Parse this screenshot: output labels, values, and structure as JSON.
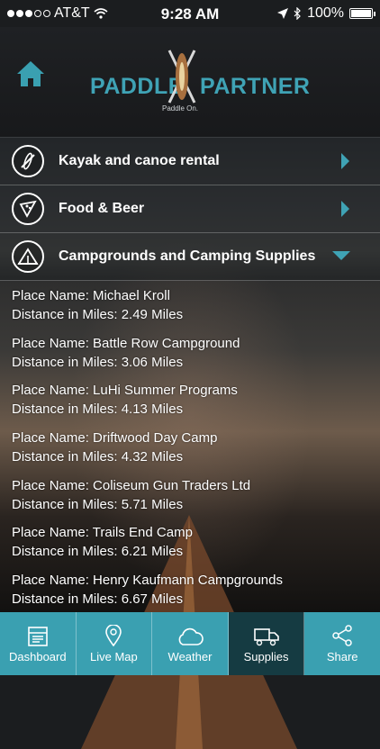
{
  "status": {
    "carrier": "AT&T",
    "time": "9:28 AM",
    "battery": "100%"
  },
  "header": {
    "logo_word1": "PADDLE",
    "logo_word2": "PARTNER",
    "tagline": "Paddle On."
  },
  "categories": [
    {
      "label": "Kayak and canoe rental",
      "icon": "kayak-icon",
      "expanded": false
    },
    {
      "label": "Food & Beer",
      "icon": "pizza-icon",
      "expanded": false
    },
    {
      "label": "Campgrounds and Camping Supplies",
      "icon": "tent-icon",
      "expanded": true
    }
  ],
  "places": [
    {
      "name": "Place Name: Michael Kroll",
      "distance": "Distance in Miles: 2.49 Miles"
    },
    {
      "name": "Place Name: Battle Row Campground",
      "distance": "Distance in Miles: 3.06 Miles"
    },
    {
      "name": "Place Name: LuHi Summer Programs",
      "distance": "Distance in Miles: 4.13 Miles"
    },
    {
      "name": "Place Name: Driftwood Day Camp",
      "distance": "Distance in Miles: 4.32 Miles"
    },
    {
      "name": "Place Name: Coliseum Gun Traders Ltd",
      "distance": "Distance in Miles: 5.71 Miles"
    },
    {
      "name": "Place Name: Trails End Camp",
      "distance": "Distance in Miles: 6.21 Miles"
    },
    {
      "name": "Place Name: Henry Kaufmann Campgrounds",
      "distance": "Distance in Miles: 6.67 Miles"
    }
  ],
  "tabs": [
    {
      "label": "Dashboard",
      "icon": "dashboard-icon"
    },
    {
      "label": "Live Map",
      "icon": "map-pin-icon"
    },
    {
      "label": "Weather",
      "icon": "cloud-icon"
    },
    {
      "label": "Supplies",
      "icon": "truck-icon",
      "active": true
    },
    {
      "label": "Share",
      "icon": "share-icon"
    }
  ],
  "colors": {
    "accent": "#3aa0b1",
    "active_tab": "#153b42"
  }
}
